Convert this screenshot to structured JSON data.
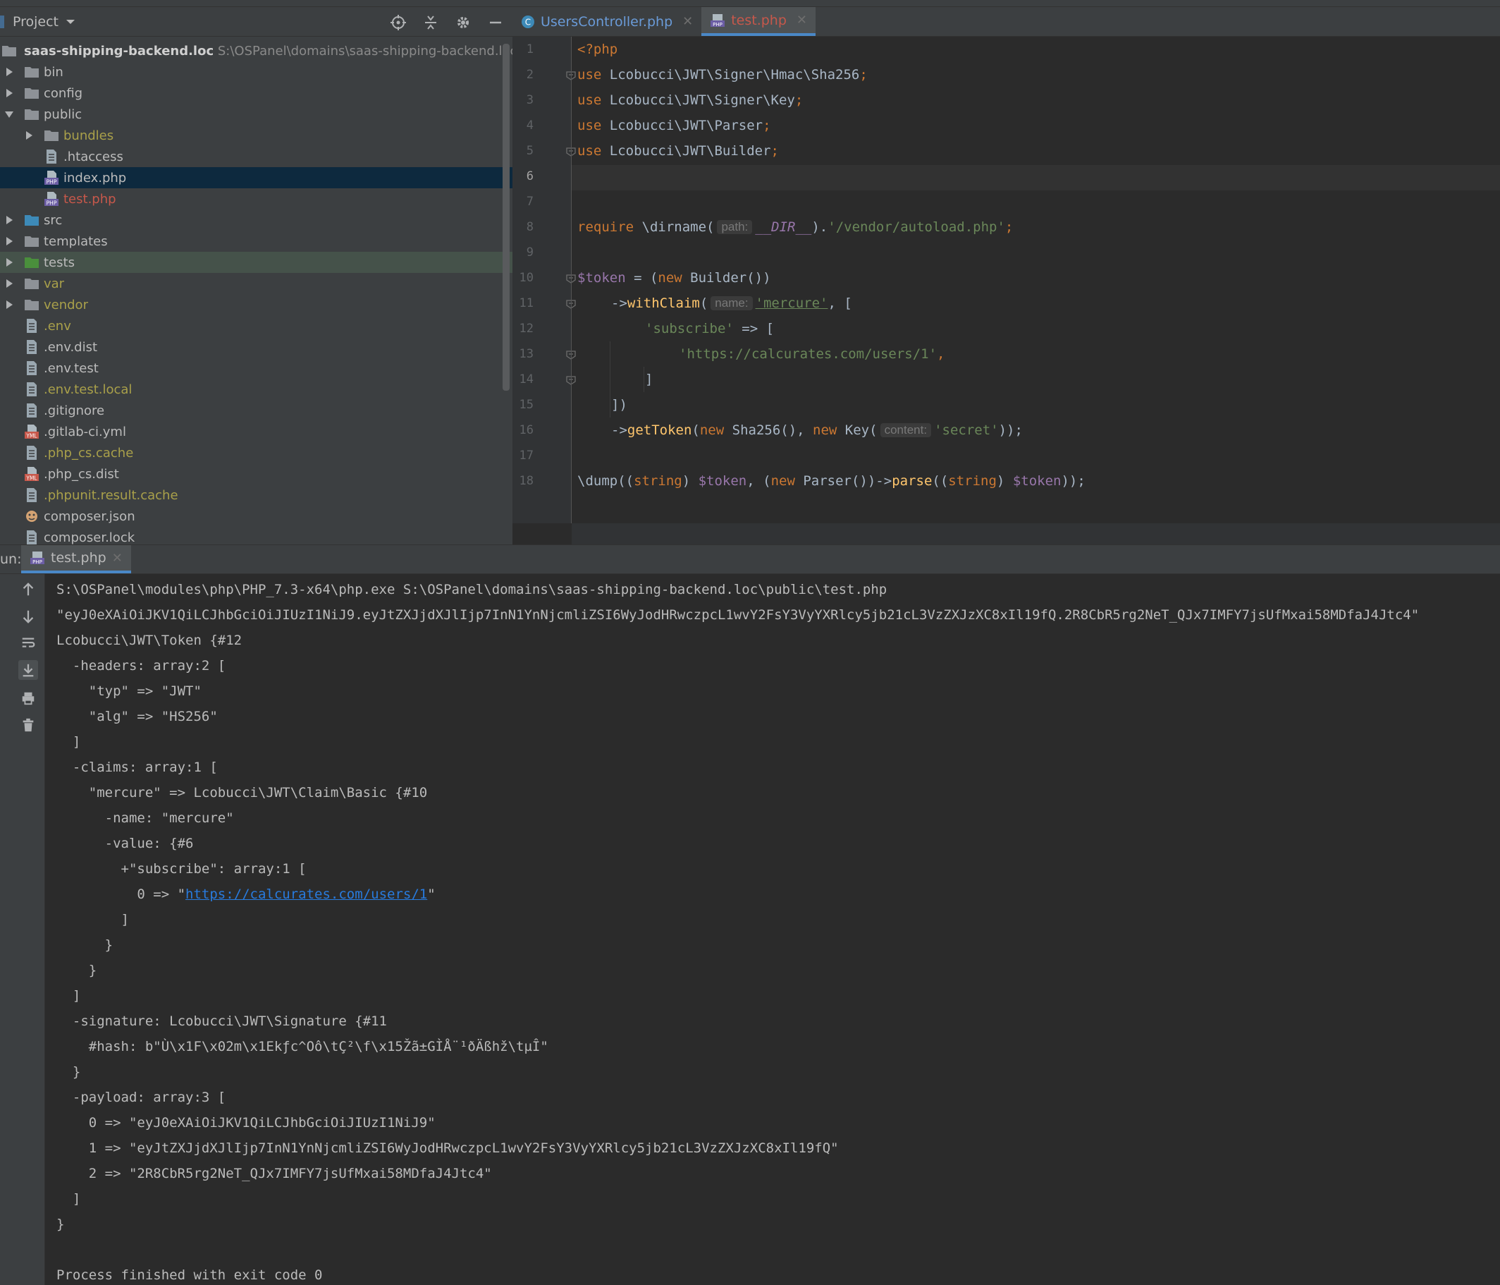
{
  "project": {
    "title": "Project",
    "root_name": "saas-shipping-backend.loc",
    "root_path": "S:\\OSPanel\\domains\\saas-shipping-backend.loc",
    "items": [
      {
        "label": "bin",
        "type": "folder"
      },
      {
        "label": "config",
        "type": "folder"
      },
      {
        "label": "public",
        "type": "folder"
      },
      {
        "label": "bundles",
        "type": "folder"
      },
      {
        "label": ".htaccess",
        "type": "file"
      },
      {
        "label": "index.php",
        "type": "php"
      },
      {
        "label": "test.php",
        "type": "php"
      },
      {
        "label": "src",
        "type": "folder"
      },
      {
        "label": "templates",
        "type": "folder"
      },
      {
        "label": "tests",
        "type": "folder"
      },
      {
        "label": "var",
        "type": "folder"
      },
      {
        "label": "vendor",
        "type": "folder"
      },
      {
        "label": ".env",
        "type": "file"
      },
      {
        "label": ".env.dist",
        "type": "file"
      },
      {
        "label": ".env.test",
        "type": "file"
      },
      {
        "label": ".env.test.local",
        "type": "file"
      },
      {
        "label": ".gitignore",
        "type": "file"
      },
      {
        "label": ".gitlab-ci.yml",
        "type": "yml"
      },
      {
        "label": ".php_cs.cache",
        "type": "file"
      },
      {
        "label": ".php_cs.dist",
        "type": "yml"
      },
      {
        "label": ".phpunit.result.cache",
        "type": "file"
      },
      {
        "label": "composer.json",
        "type": "json"
      },
      {
        "label": "composer.lock",
        "type": "file"
      }
    ]
  },
  "editor": {
    "tabs": [
      {
        "label": "UsersController.php",
        "active": false
      },
      {
        "label": "test.php",
        "active": true
      }
    ],
    "line_numbers": [
      "1",
      "2",
      "3",
      "4",
      "5",
      "6",
      "7",
      "8",
      "9",
      "10",
      "11",
      "12",
      "13",
      "14",
      "15",
      "16",
      "17",
      "18"
    ],
    "hints": {
      "path": "path:",
      "name": "name:",
      "content": "content:"
    },
    "code": {
      "l1": "<?php",
      "use_kw": "use",
      "l2": " Lcobucci\\JWT\\Signer\\Hmac\\Sha256",
      "l3": " Lcobucci\\JWT\\Signer\\Key",
      "l4": " Lcobucci\\JWT\\Parser",
      "l5": " Lcobucci\\JWT\\Builder",
      "semi": ";",
      "l7_require": "require",
      "l7_fn": " \\dirname(",
      "l7_const": "__DIR__",
      "l7_dot": ").",
      "l7_str": "'/vendor/autoload.php'",
      "l9_var": "$token",
      "l9_eq": " = (",
      "l9_new": "new",
      "l9_rest": " Builder())",
      "l10_arrow": "->",
      "l10_fn": "withClaim",
      "l10_open": "(",
      "l10_str": "'mercure'",
      "l10_rest": ", [",
      "l11_str": "'subscribe'",
      "l11_rest": " => [",
      "l12_str": "'https://calcurates.com/users/1'",
      "l12_comma": ",",
      "l13": "]",
      "l14": "])",
      "l15_arrow": "->",
      "l15_fn": "getToken",
      "l15_a": "(",
      "l15_new1": "new",
      "l15_b": " Sha256(), ",
      "l15_new2": "new",
      "l15_c": " Key(",
      "l15_str": "'secret'",
      "l15_d": "));",
      "l17_a": "\\dump((",
      "l17_string1": "string",
      "l17_b": ") ",
      "l17_var1": "$token",
      "l17_c": ", (",
      "l17_new": "new",
      "l17_d": " Parser())->",
      "l17_fn": "parse",
      "l17_e": "((",
      "l17_string2": "string",
      "l17_f": ") ",
      "l17_var2": "$token",
      "l17_g": "));"
    }
  },
  "run": {
    "label": "un:",
    "tab": "test.php",
    "output": {
      "cmd": "S:\\OSPanel\\modules\\php\\PHP_7.3-x64\\php.exe S:\\OSPanel\\domains\\saas-shipping-backend.loc\\public\\test.php",
      "jwt": "\"eyJ0eXAiOiJKV1QiLCJhbGciOiJIUzI1NiJ9.eyJtZXJjdXJlIjp7InN1YnNjcmliZSI6WyJodHRwczpcL1wvY2FsY3VyYXRlcy5jb21cL3VzZXJzXC8xIl19fQ.2R8CbR5rg2NeT_QJx7IMFY7jsUfMxai58MDfaJ4Jtc4\"",
      "l3": "Lcobucci\\JWT\\Token {#12",
      "l4": "  -headers: array:2 [",
      "l5": "    \"typ\" => \"JWT\"",
      "l6": "    \"alg\" => \"HS256\"",
      "l7": "  ]",
      "l8": "  -claims: array:1 [",
      "l9": "    \"mercure\" => Lcobucci\\JWT\\Claim\\Basic {#10",
      "l10": "      -name: \"mercure\"",
      "l11": "      -value: {#6",
      "l12": "        +\"subscribe\": array:1 [",
      "l13_pre": "          0 => \"",
      "l13_link": "https://calcurates.com/users/1",
      "l13_post": "\"",
      "l14": "        ]",
      "l15": "      }",
      "l16": "    }",
      "l17": "  ]",
      "l18": "  -signature: Lcobucci\\JWT\\Signature {#11",
      "l19": "    #hash: b\"Ù\\x1F\\x02m\\x1Ekƒc^Oô\\tÇ²\\f\\x15Žã±GÌÅ¨¹ðÄßhž\\tµÎ\"",
      "l20": "  }",
      "l21": "  -payload: array:3 [",
      "l22": "    0 => \"eyJ0eXAiOiJKV1QiLCJhbGciOiJIUzI1NiJ9\"",
      "l23": "    1 => \"eyJtZXJjdXJlIjp7InN1YnNjcmliZSI6WyJodHRwczpcL1wvY2FsY3VyYXRlcy5jb21cL3VzZXJzXC8xIl19fQ\"",
      "l24": "    2 => \"2R8CbR5rg2NeT_QJx7IMFY7jsUfMxai58MDfaJ4Jtc4\"",
      "l25": "  ]",
      "l26": "}",
      "l28": "Process finished with exit code 0"
    }
  },
  "colors": {
    "accent": "#4a88c7",
    "keyword": "#cc7832",
    "string": "#6a8759",
    "variable": "#9876aa",
    "function": "#ffc66d",
    "link": "#287bde"
  }
}
